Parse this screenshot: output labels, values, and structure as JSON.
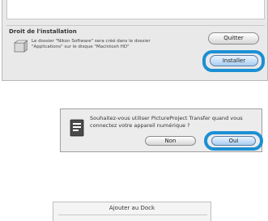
{
  "installer": {
    "heading": "Droit de l'installation",
    "message_line1": "Le dossier \"Nikon Software\" sera créé dans le dossier",
    "message_line2": "\"Applications\" sur le disque \"Macintosh HD\"",
    "quit_label": "Quitter",
    "install_label": "Installer"
  },
  "transfer_dialog": {
    "question": "Souhaitez-vous utiliser PictureProject Transfer quand vous connectez votre appareil numérique ?",
    "no_label": "Non",
    "yes_label": "Oui"
  },
  "dock_menu": {
    "item_label": "Ajouter au Dock"
  },
  "colors": {
    "highlight": "#1b8fd4",
    "dialog_bg": "#e9e9e9"
  }
}
